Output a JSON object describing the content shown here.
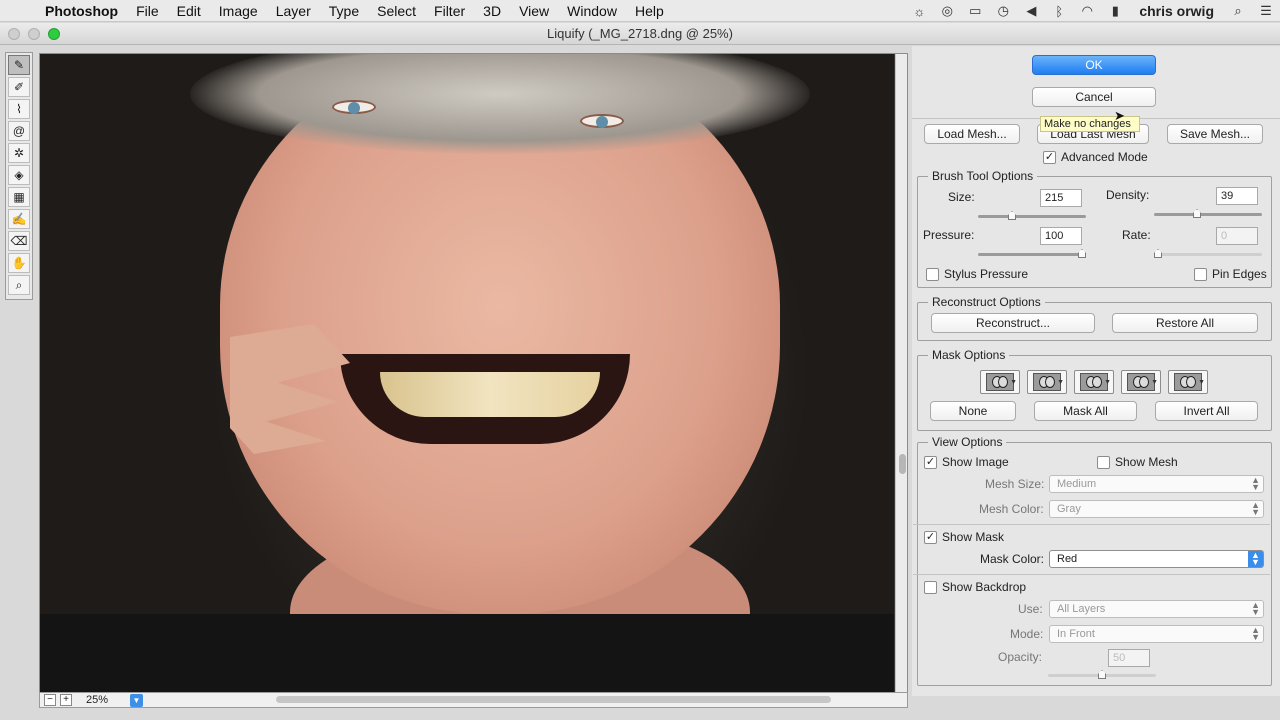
{
  "menubar": {
    "items": [
      "Photoshop",
      "File",
      "Edit",
      "Image",
      "Layer",
      "Type",
      "Select",
      "Filter",
      "3D",
      "View",
      "Window",
      "Help"
    ],
    "user": "chris orwig"
  },
  "window": {
    "title": "Liquify (_MG_2718.dng @ 25%)"
  },
  "status": {
    "zoom": "25%"
  },
  "buttons": {
    "ok": "OK",
    "cancel": "Cancel",
    "tooltip": "Make no changes",
    "load_mesh": "Load Mesh...",
    "load_last_mesh": "Load Last Mesh",
    "save_mesh": "Save Mesh..."
  },
  "advanced_mode": {
    "label": "Advanced Mode",
    "checked": true
  },
  "brush": {
    "title": "Brush Tool Options",
    "size_label": "Size:",
    "size": "215",
    "density_label": "Density:",
    "density": "39",
    "pressure_label": "Pressure:",
    "pressure": "100",
    "rate_label": "Rate:",
    "rate": "0",
    "stylus_label": "Stylus Pressure",
    "pin_edges_label": "Pin Edges",
    "size_level": 0.3,
    "density_level": 0.39,
    "pressure_level": 1.0,
    "rate_level": 0.0
  },
  "reconstruct": {
    "title": "Reconstruct Options",
    "reconstruct_btn": "Reconstruct...",
    "restore_all_btn": "Restore All"
  },
  "mask": {
    "title": "Mask Options",
    "none_btn": "None",
    "mask_all_btn": "Mask All",
    "invert_all_btn": "Invert All"
  },
  "view": {
    "title": "View Options",
    "show_image": "Show Image",
    "show_mesh": "Show Mesh",
    "mesh_size_label": "Mesh Size:",
    "mesh_size": "Medium",
    "mesh_color_label": "Mesh Color:",
    "mesh_color": "Gray",
    "show_mask": "Show Mask",
    "mask_color_label": "Mask Color:",
    "mask_color": "Red",
    "show_backdrop": "Show Backdrop",
    "use_label": "Use:",
    "use": "All Layers",
    "mode_label": "Mode:",
    "mode": "In Front",
    "opacity_label": "Opacity:",
    "opacity": "50"
  },
  "colors": {
    "accent": "#1e7ef2",
    "tooltip": "#fefdc8"
  }
}
